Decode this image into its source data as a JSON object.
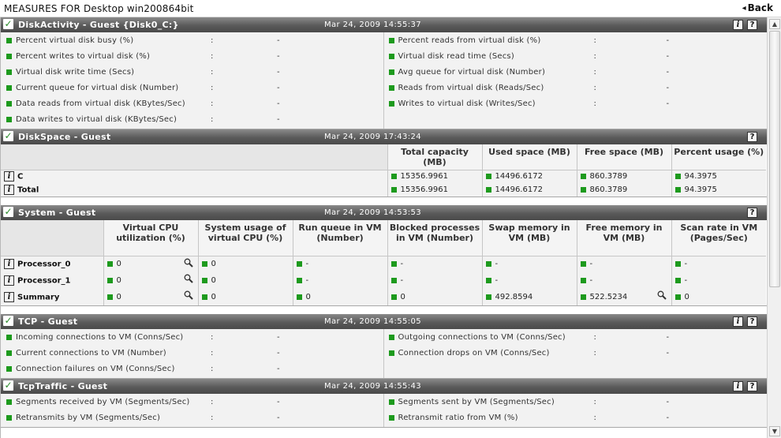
{
  "app": {
    "title": "MEASURES FOR Desktop win200864bit",
    "back_label": "Back"
  },
  "sections": {
    "disk_activity": {
      "name": "DiskActivity - Guest {Disk0_C:}",
      "timestamp": "Mar 24, 2009 14:55:37",
      "left": [
        {
          "label": "Percent virtual disk busy (%)",
          "value": "-"
        },
        {
          "label": "Percent writes to virtual disk (%)",
          "value": "-"
        },
        {
          "label": "Virtual disk write time (Secs)",
          "value": "-"
        },
        {
          "label": "Current queue for virtual disk (Number)",
          "value": "-"
        },
        {
          "label": "Data reads from virtual disk (KBytes/Sec)",
          "value": "-"
        },
        {
          "label": "Data writes to virtual disk (KBytes/Sec)",
          "value": "-"
        }
      ],
      "right": [
        {
          "label": "Percent reads from virtual disk (%)",
          "value": "-"
        },
        {
          "label": "Virtual disk read time (Secs)",
          "value": "-"
        },
        {
          "label": "Avg queue for virtual disk (Number)",
          "value": "-"
        },
        {
          "label": "Reads from virtual disk (Reads/Sec)",
          "value": "-"
        },
        {
          "label": "Writes to virtual disk (Writes/Sec)",
          "value": "-"
        }
      ]
    },
    "disk_space": {
      "name": "DiskSpace - Guest",
      "timestamp": "Mar 24, 2009 17:43:24",
      "columns": [
        "Total capacity (MB)",
        "Used space (MB)",
        "Free space (MB)",
        "Percent usage (%)"
      ],
      "rows": [
        {
          "label": "C",
          "values": [
            "15356.9961",
            "14496.6172",
            "860.3789",
            "94.3975"
          ]
        },
        {
          "label": "Total",
          "values": [
            "15356.9961",
            "14496.6172",
            "860.3789",
            "94.3975"
          ]
        }
      ]
    },
    "system": {
      "name": "System - Guest",
      "timestamp": "Mar 24, 2009 14:53:53",
      "columns": [
        "Virtual CPU utilization (%)",
        "System usage of virtual CPU (%)",
        "Run queue in VM (Number)",
        "Blocked processes in VM (Number)",
        "Swap memory in VM (MB)",
        "Free memory in VM (MB)",
        "Scan rate in VM (Pages/Sec)"
      ],
      "rows": [
        {
          "label": "Processor_0",
          "values": [
            "0",
            "0",
            "-",
            "-",
            "-",
            "-",
            "-"
          ]
        },
        {
          "label": "Processor_1",
          "values": [
            "0",
            "0",
            "-",
            "-",
            "-",
            "-",
            "-"
          ]
        },
        {
          "label": "Summary",
          "values": [
            "0",
            "0",
            "0",
            "0",
            "492.8594",
            "522.5234",
            "0"
          ]
        }
      ]
    },
    "tcp": {
      "name": "TCP - Guest",
      "timestamp": "Mar 24, 2009 14:55:05",
      "left": [
        {
          "label": "Incoming connections to VM (Conns/Sec)",
          "value": "-"
        },
        {
          "label": "Current connections to VM (Number)",
          "value": "-"
        },
        {
          "label": "Connection failures on VM (Conns/Sec)",
          "value": "-"
        }
      ],
      "right": [
        {
          "label": "Outgoing connections to VM (Conns/Sec)",
          "value": "-"
        },
        {
          "label": "Connection drops on VM (Conns/Sec)",
          "value": "-"
        }
      ]
    },
    "tcp_traffic": {
      "name": "TcpTraffic - Guest",
      "timestamp": "Mar 24, 2009 14:55:43",
      "left": [
        {
          "label": "Segments received by VM (Segments/Sec)",
          "value": "-"
        },
        {
          "label": "Retransmits by VM (Segments/Sec)",
          "value": "-"
        }
      ],
      "right": [
        {
          "label": "Segments sent by VM (Segments/Sec)",
          "value": "-"
        },
        {
          "label": "Retransmit ratio from VM (%)",
          "value": "-"
        }
      ]
    }
  },
  "icons": {
    "check": "✓",
    "info": "i",
    "help": "?",
    "magnifier": "🔍",
    "back": "«"
  },
  "colors": {
    "status_green": "#1d9a1d",
    "header_dark": "#4a4a4a"
  }
}
